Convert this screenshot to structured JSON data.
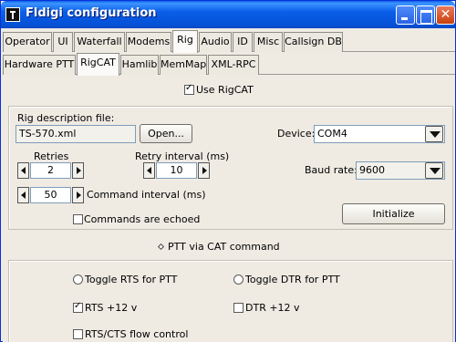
{
  "window": {
    "title": "Fldigi configuration"
  },
  "tabs_main": [
    "Operator",
    "UI",
    "Waterfall",
    "Modems",
    "Rig",
    "Audio",
    "ID",
    "Misc",
    "Callsign DB"
  ],
  "tabs_rig": [
    "Hardware PTT",
    "RigCAT",
    "Hamlib",
    "MemMap",
    "XML-RPC"
  ],
  "rigcat": {
    "use_rigcat_label": "Use RigCAT",
    "rig_desc_label": "Rig description file:",
    "rig_desc_value": "TS-570.xml",
    "open_button": "Open...",
    "device_label": "Device:",
    "device_value": "COM4",
    "retries_label": "Retries",
    "retries_value": "2",
    "retry_interval_label": "Retry interval (ms)",
    "retry_interval_value": "10",
    "baud_label": "Baud rate:",
    "baud_value": "9600",
    "cmd_interval_value": "50",
    "cmd_interval_label": "Command interval (ms)",
    "echo_label": "Commands are echoed",
    "initialize_button": "Initialize",
    "ptt_cat_label": "PTT via CAT command",
    "toggle_rts_label": "Toggle RTS for PTT",
    "toggle_dtr_label": "Toggle DTR for PTT",
    "rts_label": "RTS +12 v",
    "dtr_label": "DTR +12 v",
    "rtscts_label": "RTS/CTS flow control"
  }
}
